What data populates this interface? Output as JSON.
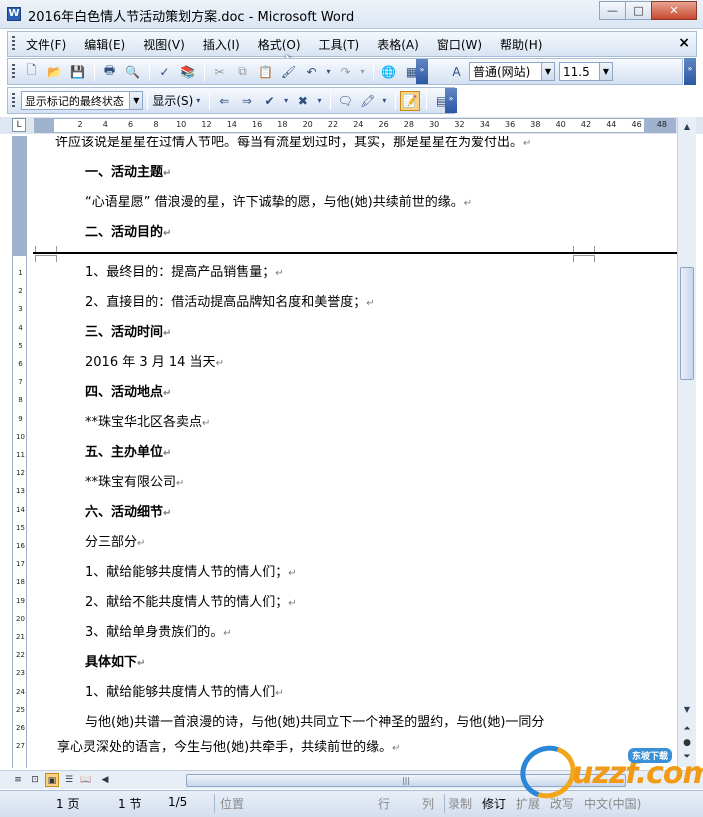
{
  "window": {
    "title": "2016年白色情人节活动策划方案.doc - Microsoft Word",
    "app_icon": "W",
    "buttons": {
      "minimize": "—",
      "maximize": "□",
      "close": "✕"
    }
  },
  "menubar": {
    "items": [
      "文件(F)",
      "编辑(E)",
      "视图(V)",
      "插入(I)",
      "格式(O)",
      "工具(T)",
      "表格(A)",
      "窗口(W)",
      "帮助(H)"
    ],
    "close_doc": "×"
  },
  "toolbar_standard": {
    "style_value": "普通(网站)",
    "font_size_value": "11.5"
  },
  "toolbar_review": {
    "display_value": "显示标记的最终状态",
    "show_label": "显示(S)"
  },
  "ruler": {
    "corner": "L",
    "ticks": [
      "2",
      "4",
      "6",
      "8",
      "10",
      "12",
      "14",
      "16",
      "18",
      "20",
      "22",
      "24",
      "26",
      "28",
      "30",
      "32",
      "34",
      "36",
      "38",
      "40",
      "42",
      "44",
      "46",
      "48"
    ],
    "vticks": [
      "1",
      "2",
      "3",
      "4",
      "5",
      "6",
      "7",
      "8",
      "9",
      "10",
      "11",
      "12",
      "13",
      "14",
      "15",
      "16",
      "17",
      "18",
      "19",
      "20",
      "21",
      "22",
      "23",
      "24",
      "25",
      "26",
      "27"
    ]
  },
  "document": {
    "para_mark": "↵",
    "top_fragment": "许应该说是星星在过情人节吧。每当有流星划过时，其实，那是星星在为爱付出。",
    "h1": "一、活动主题",
    "p1": "“心语星愿” 借浪漫的星，许下诚挚的愿，与他(她)共续前世的缘。",
    "h2": "二、活动目的",
    "p2a": "1、最终目的：提高产品销售量；",
    "p2b": "2、直接目的：借活动提高品牌知名度和美誉度；",
    "h3": "三、活动时间",
    "p3": "2016 年 3 月 14 当天",
    "h4": "四、活动地点",
    "p4": "**珠宝华北区各卖点",
    "h5": "五、主办单位",
    "p5": "**珠宝有限公司",
    "h6": "六、活动细节",
    "p6": "分三部分",
    "p6a": "1、献给能够共度情人节的情人们；",
    "p6b": "2、献给不能共度情人节的情人们；",
    "p6c": "3、献给单身贵族们的。",
    "h7": "具体如下",
    "p7": "1、献给能够共度情人节的情人们",
    "p8a": "与他(她)共谱一首浪漫的诗，与他(她)共同立下一个神圣的盟约，与他(她)一同分",
    "p8b": "享心灵深处的语言，今生与他(她)共牵手，共续前世的缘。"
  },
  "statusbar": {
    "page": "1 页",
    "section": "1 节",
    "pages": "1/5",
    "position": "位置",
    "line": "行",
    "column": "列",
    "rec": "录制",
    "trk": "修订",
    "ext": "扩展",
    "ovr": "改写",
    "lang": "中文(中国)"
  },
  "watermark": {
    "text": "uzzf.com",
    "tag": "东坡下载"
  }
}
